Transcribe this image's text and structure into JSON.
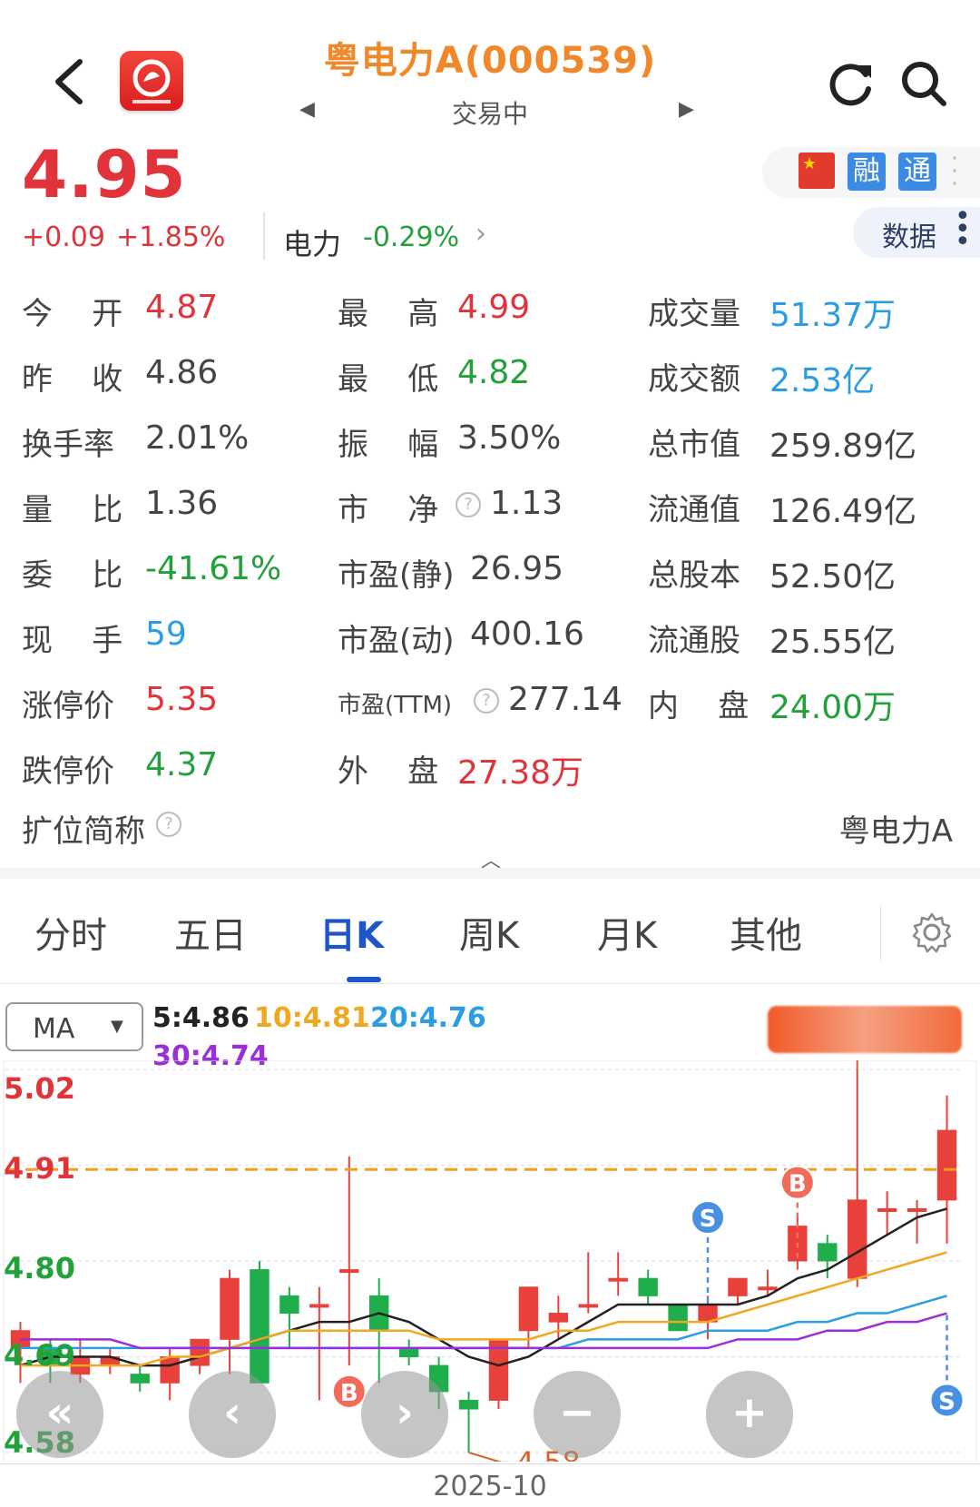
{
  "header": {
    "title": "粤电力A(000539)",
    "status": "交易中",
    "prev_arrow": "◀",
    "next_arrow": "▶"
  },
  "quote": {
    "price": "4.95",
    "change_abs": "+0.09",
    "change_pct": "+1.85%",
    "sector_name": "电力",
    "sector_pct": "-0.29%",
    "data_button": "数据",
    "tags": [
      "融",
      "通"
    ]
  },
  "stats": {
    "col1": [
      {
        "label": "今    开",
        "value": "4.87",
        "color": "red"
      },
      {
        "label": "昨    收",
        "value": "4.86",
        "color": "normal"
      },
      {
        "label": "换手率",
        "value": "2.01%",
        "color": "normal"
      },
      {
        "label": "量    比",
        "value": "1.36",
        "color": "normal"
      },
      {
        "label": "委    比",
        "value": "-41.61%",
        "color": "green"
      },
      {
        "label": "现    手",
        "value": "59",
        "color": "blue"
      },
      {
        "label": "涨停价",
        "value": "5.35",
        "color": "red"
      },
      {
        "label": "跌停价",
        "value": "4.37",
        "color": "green"
      }
    ],
    "col2": [
      {
        "label": "最    高",
        "value": "4.99",
        "color": "red"
      },
      {
        "label": "最    低",
        "value": "4.82",
        "color": "green"
      },
      {
        "label": "振    幅",
        "value": "3.50%",
        "color": "normal"
      },
      {
        "label": "市    净",
        "value": "1.13",
        "color": "normal"
      },
      {
        "label": "市盈(静)",
        "value": "26.95",
        "color": "normal"
      },
      {
        "label": "市盈(动)",
        "value": "400.16",
        "color": "normal"
      },
      {
        "label": "市盈(TTM)",
        "value": "277.14",
        "color": "normal"
      },
      {
        "label": "外    盘",
        "value": "27.38万",
        "color": "red"
      }
    ],
    "col3": [
      {
        "label": "成交量",
        "value": "51.37万",
        "color": "blue"
      },
      {
        "label": "成交额",
        "value": "2.53亿",
        "color": "blue"
      },
      {
        "label": "总市值",
        "value": "259.89亿",
        "color": "normal"
      },
      {
        "label": "流通值",
        "value": "126.49亿",
        "color": "normal"
      },
      {
        "label": "总股本",
        "value": "52.50亿",
        "color": "normal"
      },
      {
        "label": "流通股",
        "value": "25.55亿",
        "color": "normal"
      },
      {
        "label": "内    盘",
        "value": "24.00万",
        "color": "green"
      }
    ],
    "ext_name_label": "扩位简称",
    "ext_name_value": "粤电力A"
  },
  "tabs": [
    {
      "label": "分时"
    },
    {
      "label": "五日"
    },
    {
      "label": "日K"
    },
    {
      "label": "周K"
    },
    {
      "label": "月K"
    },
    {
      "label": "其他"
    }
  ],
  "chart_controls": {
    "indicator": "MA",
    "ma5": "5:4.86",
    "ma10": "10:4.81",
    "ma20": "20:4.76",
    "ma30": "30:4.74",
    "nav": [
      "«",
      "‹",
      "›",
      "−",
      "+"
    ]
  },
  "chart_data": {
    "type": "candlestick",
    "y_ticks": [
      "5.02",
      "4.91",
      "4.80",
      "4.69",
      "4.58"
    ],
    "ylim": [
      4.58,
      5.02
    ],
    "x_label": "2025-10",
    "ref_line": 4.905,
    "annotations": {
      "high": "5.02",
      "low": "4.58",
      "buy": "B",
      "sell": "S"
    },
    "candles": [
      {
        "o": 4.7,
        "c": 4.72,
        "h": 4.73,
        "l": 4.66
      },
      {
        "o": 4.7,
        "c": 4.68,
        "h": 4.71,
        "l": 4.66
      },
      {
        "o": 4.67,
        "c": 4.69,
        "h": 4.71,
        "l": 4.66
      },
      {
        "o": 4.68,
        "c": 4.69,
        "h": 4.7,
        "l": 4.67
      },
      {
        "o": 4.67,
        "c": 4.66,
        "h": 4.68,
        "l": 4.65
      },
      {
        "o": 4.66,
        "c": 4.69,
        "h": 4.7,
        "l": 4.64
      },
      {
        "o": 4.68,
        "c": 4.71,
        "h": 4.71,
        "l": 4.67
      },
      {
        "o": 4.71,
        "c": 4.78,
        "h": 4.79,
        "l": 4.67
      },
      {
        "o": 4.79,
        "c": 4.66,
        "h": 4.8,
        "l": 4.66
      },
      {
        "o": 4.76,
        "c": 4.74,
        "h": 4.77,
        "l": 4.7
      },
      {
        "o": 4.75,
        "c": 4.75,
        "h": 4.77,
        "l": 4.64
      },
      {
        "o": 4.79,
        "c": 4.79,
        "h": 4.92,
        "l": 4.68
      },
      {
        "o": 4.76,
        "c": 4.72,
        "h": 4.78,
        "l": 4.66
      },
      {
        "o": 4.7,
        "c": 4.69,
        "h": 4.71,
        "l": 4.68
      },
      {
        "o": 4.68,
        "c": 4.65,
        "h": 4.69,
        "l": 4.63
      },
      {
        "o": 4.64,
        "c": 4.63,
        "h": 4.65,
        "l": 4.58
      },
      {
        "o": 4.64,
        "c": 4.71,
        "h": 4.71,
        "l": 4.63
      },
      {
        "o": 4.72,
        "c": 4.77,
        "h": 4.77,
        "l": 4.7
      },
      {
        "o": 4.73,
        "c": 4.74,
        "h": 4.76,
        "l": 4.71
      },
      {
        "o": 4.75,
        "c": 4.75,
        "h": 4.81,
        "l": 4.74
      },
      {
        "o": 4.78,
        "c": 4.78,
        "h": 4.81,
        "l": 4.76
      },
      {
        "o": 4.78,
        "c": 4.76,
        "h": 4.79,
        "l": 4.75
      },
      {
        "o": 4.75,
        "c": 4.72,
        "h": 4.75,
        "l": 4.72
      },
      {
        "o": 4.73,
        "c": 4.75,
        "h": 4.76,
        "l": 4.71
      },
      {
        "o": 4.76,
        "c": 4.78,
        "h": 4.78,
        "l": 4.75
      },
      {
        "o": 4.77,
        "c": 4.77,
        "h": 4.79,
        "l": 4.76
      },
      {
        "o": 4.8,
        "c": 4.84,
        "h": 4.85,
        "l": 4.79
      },
      {
        "o": 4.82,
        "c": 4.8,
        "h": 4.83,
        "l": 4.78
      },
      {
        "o": 4.78,
        "c": 4.87,
        "h": 5.02,
        "l": 4.77
      },
      {
        "o": 4.86,
        "c": 4.86,
        "h": 4.88,
        "l": 4.83
      },
      {
        "o": 4.86,
        "c": 4.86,
        "h": 4.87,
        "l": 4.82
      },
      {
        "o": 4.87,
        "c": 4.95,
        "h": 4.99,
        "l": 4.82
      }
    ],
    "ma_lines": [
      {
        "name": "5",
        "color": "#222222",
        "values": [
          4.68,
          4.69,
          4.69,
          4.69,
          4.68,
          4.68,
          4.69,
          4.7,
          4.71,
          4.72,
          4.73,
          4.73,
          4.74,
          4.73,
          4.71,
          4.69,
          4.68,
          4.69,
          4.71,
          4.73,
          4.75,
          4.75,
          4.75,
          4.75,
          4.75,
          4.76,
          4.78,
          4.79,
          4.81,
          4.83,
          4.85,
          4.86
        ]
      },
      {
        "name": "10",
        "color": "#f0a820",
        "values": [
          4.68,
          4.68,
          4.68,
          4.68,
          4.68,
          4.69,
          4.69,
          4.7,
          4.71,
          4.72,
          4.72,
          4.72,
          4.72,
          4.72,
          4.71,
          4.71,
          4.71,
          4.71,
          4.72,
          4.72,
          4.73,
          4.73,
          4.73,
          4.73,
          4.74,
          4.75,
          4.76,
          4.77,
          4.78,
          4.79,
          4.8,
          4.81
        ]
      },
      {
        "name": "20",
        "color": "#2a9de5",
        "values": [
          4.7,
          4.7,
          4.7,
          4.7,
          4.7,
          4.7,
          4.7,
          4.7,
          4.7,
          4.7,
          4.7,
          4.7,
          4.7,
          4.7,
          4.7,
          4.7,
          4.7,
          4.7,
          4.7,
          4.71,
          4.71,
          4.71,
          4.71,
          4.72,
          4.72,
          4.72,
          4.73,
          4.73,
          4.74,
          4.74,
          4.75,
          4.76
        ]
      },
      {
        "name": "30",
        "color": "#9a2ed8",
        "values": [
          4.71,
          4.71,
          4.71,
          4.71,
          4.7,
          4.7,
          4.7,
          4.7,
          4.7,
          4.7,
          4.7,
          4.7,
          4.7,
          4.7,
          4.7,
          4.7,
          4.7,
          4.7,
          4.7,
          4.7,
          4.7,
          4.7,
          4.7,
          4.7,
          4.71,
          4.71,
          4.71,
          4.72,
          4.72,
          4.73,
          4.73,
          4.74
        ]
      }
    ]
  }
}
